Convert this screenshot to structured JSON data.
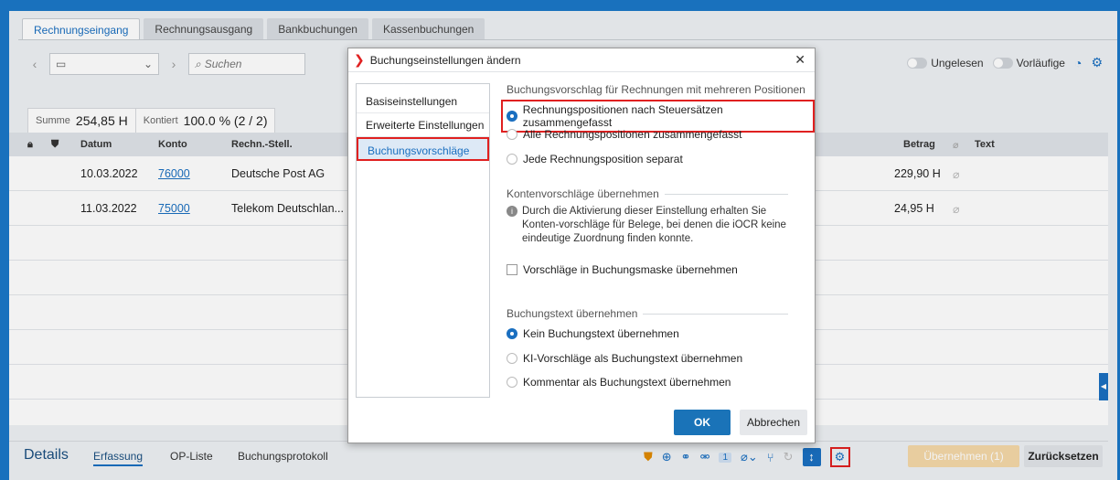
{
  "tabs": [
    "Rechnungseingang",
    "Rechnungsausgang",
    "Bankbuchungen",
    "Kassenbuchungen"
  ],
  "toolbar": {
    "search_placeholder": "Suchen"
  },
  "filters": {
    "unread": "Ungelesen",
    "preliminary": "Vorläufige"
  },
  "summary": {
    "sum_label": "Summe",
    "sum_value": "254,85 H",
    "kontiert_label": "Kontiert",
    "kontiert_value": "100.0 % (2 / 2)"
  },
  "table": {
    "headers": {
      "datum": "Datum",
      "konto": "Konto",
      "rechn": "Rechn.-Stell.",
      "betrag": "Betrag",
      "text": "Text"
    },
    "rows": [
      {
        "datum": "10.03.2022",
        "konto": "76000",
        "rechn": "Deutsche Post AG",
        "betrag": "229,90 H"
      },
      {
        "datum": "11.03.2022",
        "konto": "75000",
        "rechn": "Telekom Deutschlan...",
        "betrag": "24,95 H"
      }
    ]
  },
  "bottom": {
    "details": "Details",
    "tabs": [
      "Erfassung",
      "OP-Liste",
      "Buchungsprotokoll"
    ],
    "badge": "1",
    "apply": "Übernehmen (1)",
    "reset": "Zurücksetzen"
  },
  "dialog": {
    "title": "Buchungseinstellungen ändern",
    "nav": [
      "Basiseinstellungen",
      "Erweiterte Einstellungen",
      "Buchungsvorschläge"
    ],
    "section1": "Buchungsvorschlag für Rechnungen mit mehreren Positionen",
    "section1_options": [
      "Rechnungspositionen nach Steuersätzen zusammengefasst",
      "Alle Rechnungspositionen zusammengefasst",
      "Jede Rechnungsposition separat"
    ],
    "section2": "Kontenvorschläge übernehmen",
    "info_text": "Durch die Aktivierung dieser Einstellung erhalten Sie Konten-vorschläge für Belege, bei denen die iOCR keine eindeutige Zuordnung finden konnte.",
    "checkbox_label": "Vorschläge in Buchungsmaske übernehmen",
    "section3": "Buchungstext übernehmen",
    "section3_options": [
      "Kein Buchungstext übernehmen",
      "KI-Vorschläge als Buchungstext übernehmen",
      "Kommentar als Buchungstext übernehmen"
    ],
    "ok": "OK",
    "cancel": "Abbrechen"
  },
  "colors": {
    "accent": "#1a6fc0",
    "highlight": "#e02020",
    "warning": "#e08a00"
  }
}
